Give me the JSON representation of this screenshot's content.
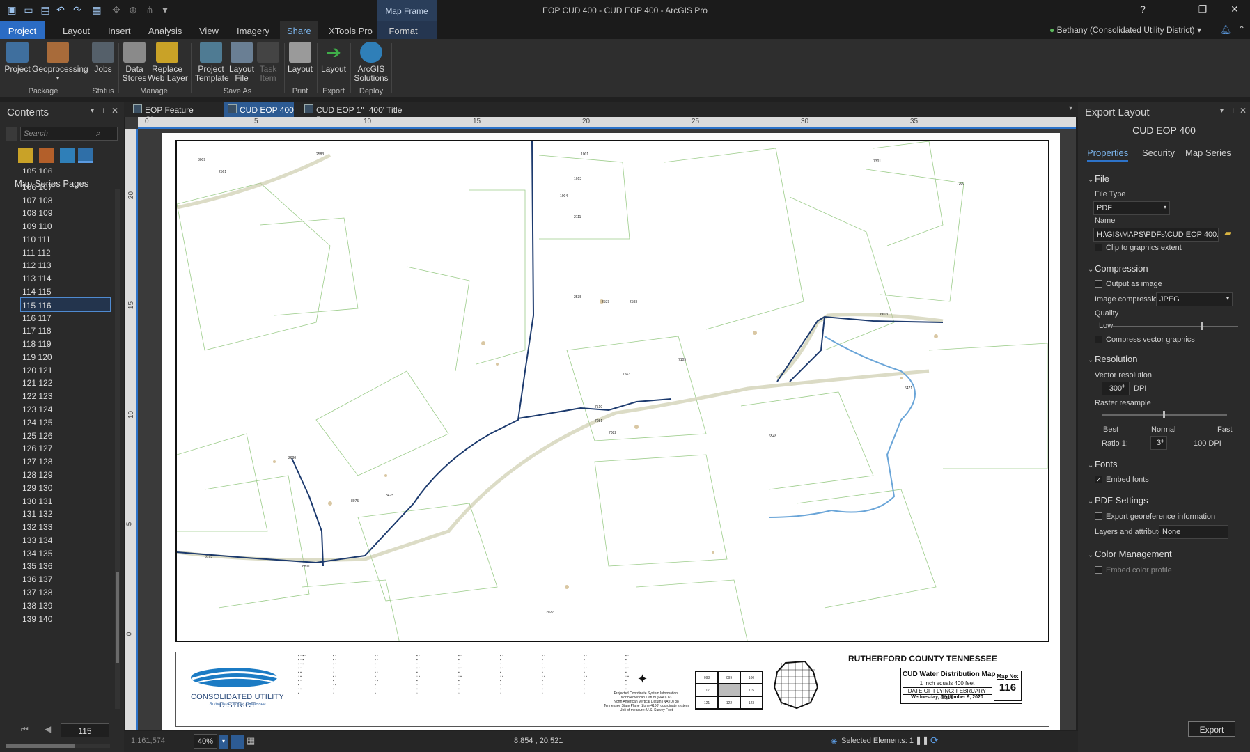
{
  "app": {
    "title": "EOP CUD 400 - CUD EOP 400 - ArcGIS Pro",
    "context_tab": "Map Frame",
    "user": "Bethany (Consolidated Utility District)"
  },
  "tabs": [
    "Project",
    "Layout",
    "Insert",
    "Analysis",
    "View",
    "Imagery",
    "Share",
    "XTools Pro",
    "Format"
  ],
  "ribbon": {
    "buttons": [
      {
        "label": "Project",
        "group": "Package"
      },
      {
        "label": "Geoprocessing",
        "group": "Package"
      },
      {
        "label": "Jobs",
        "group": "Status"
      },
      {
        "label": "Data\nStores",
        "group": "Manage"
      },
      {
        "label": "Replace\nWeb Layer",
        "group": "Manage"
      },
      {
        "label": "Project\nTemplate",
        "group": "Save As"
      },
      {
        "label": "Layout\nFile",
        "group": "Save As"
      },
      {
        "label": "Task\nItem",
        "group": "Save As"
      },
      {
        "label": "Layout",
        "group": "Print"
      },
      {
        "label": "Layout",
        "group": "Export"
      },
      {
        "label": "ArcGIS\nSolutions",
        "group": "Deploy"
      }
    ],
    "groups": [
      "Package",
      "Status",
      "Manage",
      "Save As",
      "Print",
      "Export",
      "Deploy"
    ]
  },
  "contents": {
    "title": "Contents",
    "search_placeholder": "Search",
    "section": "Map Series Pages",
    "pages": [
      "105  106",
      "106  107",
      "107  108",
      "108  109",
      "109  110",
      "110  111",
      "111  112",
      "112  113",
      "113  114",
      "114  115",
      "115  116",
      "116  117",
      "117  118",
      "118  119",
      "119  120",
      "120  121",
      "121  122",
      "122  123",
      "123  124",
      "124  125",
      "125  126",
      "126  127",
      "127  128",
      "128  129",
      "129  130",
      "130  131",
      "131  132",
      "132  133",
      "133  134",
      "134  135",
      "135  136",
      "136  137",
      "137  138",
      "138  139",
      "139  140"
    ],
    "selected_index": 10,
    "page_input": "115"
  },
  "view_tabs": [
    {
      "label": "EOP Feature Classes",
      "active": false
    },
    {
      "label": "CUD EOP 400",
      "active": true
    },
    {
      "label": "CUD EOP 1\"=400' Title Page",
      "active": false
    }
  ],
  "rulers": {
    "h": [
      "0",
      "5",
      "10",
      "15",
      "20",
      "25",
      "30",
      "35"
    ],
    "v": [
      "20",
      "15",
      "10",
      "5",
      "0"
    ]
  },
  "legend": {
    "company": "CONSOLIDATED UTILITY DISTRICT",
    "company_sub": "Rutherford County, Tennessee",
    "county": "RUTHERFORD COUNTY TENNESSEE",
    "map_title": "CUD Water Distribution Map",
    "scale_text": "1 Inch equals 400 feet",
    "flying": "DATE OF FLYING: FEBRUARY 2019",
    "date": "Wednesday, September 9, 2020",
    "map_no_label": "Map No:",
    "map_no": "116",
    "grid": [
      "098",
      "099",
      "100",
      "117",
      "",
      "115",
      "121",
      "122",
      "123"
    ],
    "coord_text": "Projected Coordinate System Information:\nNorth American Datum (NAD) 83\nNorth American Vertical Datum (NAVD) 88\nTennessee State Plane (Zone 4100) coordinate system\nUnit of measure: U.S. Survey Foot"
  },
  "export_pane": {
    "title": "Export Layout",
    "subtitle": "CUD EOP 400",
    "tabs": [
      "Properties",
      "Security",
      "Map Series"
    ],
    "file_section": "File",
    "file_type_label": "File Type",
    "file_type": "PDF",
    "name_label": "Name",
    "name_value": "H:\\GIS\\MAPS\\PDFs\\CUD EOP 400.p",
    "clip": "Clip to graphics extent",
    "compression_section": "Compression",
    "output_image": "Output as image",
    "image_compression_label": "Image compression",
    "image_compression": "JPEG",
    "quality_label": "Quality",
    "quality_value": "Low",
    "compress_vector": "Compress vector graphics",
    "resolution_section": "Resolution",
    "vector_res_label": "Vector resolution",
    "vector_res": "300",
    "dpi": "DPI",
    "raster_label": "Raster resample",
    "best": "Best",
    "normal": "Normal",
    "fast": "Fast",
    "ratio_label": "Ratio 1:",
    "ratio": "3",
    "ratio_dpi": "100  DPI",
    "fonts_section": "Fonts",
    "embed_fonts": "Embed fonts",
    "pdf_section": "PDF Settings",
    "georef": "Export georeference information",
    "layers_label": "Layers and attributes",
    "layers_value": "None",
    "color_section": "Color Management",
    "embed_color": "Embed color profile",
    "export_button": "Export"
  },
  "status": {
    "scale": "1:161,574",
    "zoom": "40%",
    "coords": "8.854 , 20.521",
    "selected": "Selected Elements: 1"
  }
}
